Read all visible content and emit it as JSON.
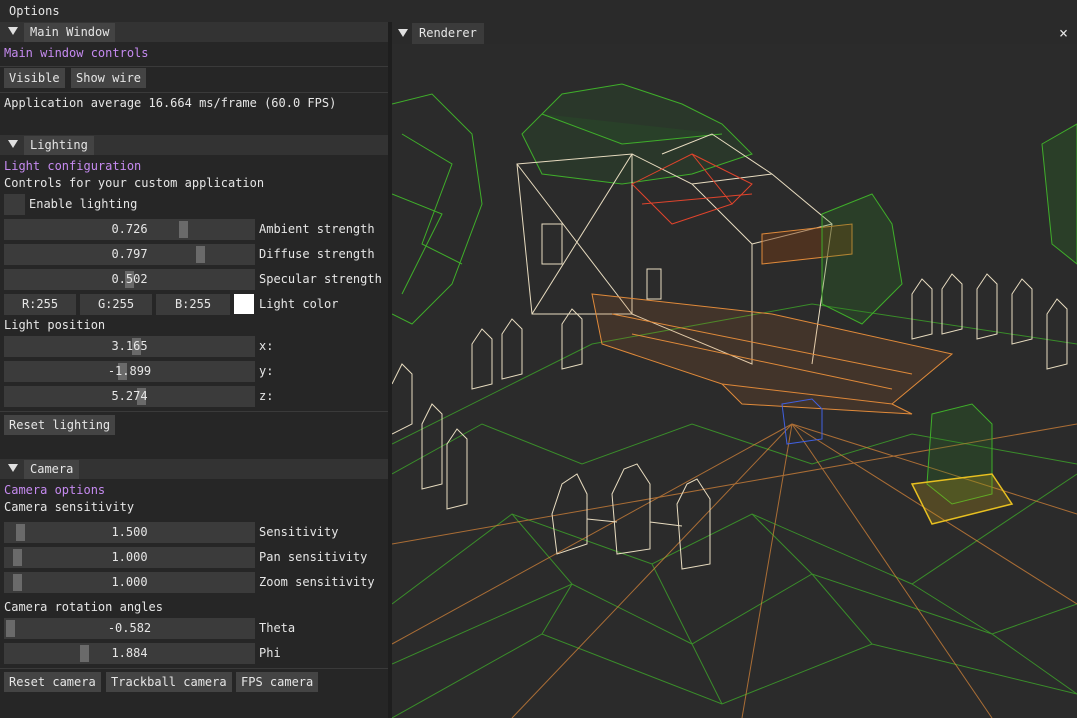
{
  "window_title": "Options",
  "main_window": {
    "header": "Main Window",
    "section_label": "Main window controls",
    "visible_button": "Visible",
    "show_wire_button": "Show wire",
    "fps_text": "Application average 16.664 ms/frame (60.0 FPS)"
  },
  "lighting": {
    "header": "Lighting",
    "section_label": "Light configuration",
    "subtitle": "Controls for your custom application",
    "enable_label": "Enable lighting",
    "enable_checked": false,
    "ambient": {
      "value": "0.726",
      "fraction": 0.726,
      "label": "Ambient strength"
    },
    "diffuse": {
      "value": "0.797",
      "fraction": 0.797,
      "label": "Diffuse strength"
    },
    "specular": {
      "value": "0.502",
      "fraction": 0.502,
      "label": "Specular strength"
    },
    "color": {
      "r": "R:255",
      "g": "G:255",
      "b": "B:255",
      "label": "Light color",
      "swatch": "#ffffff"
    },
    "position_label": "Light position",
    "pos_x": {
      "value": "3.165",
      "fraction": 0.53,
      "label": "x:"
    },
    "pos_y": {
      "value": "-1.899",
      "fraction": 0.47,
      "label": "y:"
    },
    "pos_z": {
      "value": "5.274",
      "fraction": 0.55,
      "label": "z:"
    },
    "reset_button": "Reset lighting"
  },
  "camera": {
    "header": "Camera",
    "section_label": "Camera options",
    "sensitivity_label": "Camera sensitivity",
    "sensitivity": {
      "value": "1.500",
      "fraction": 0.04,
      "label": "Sensitivity"
    },
    "pan": {
      "value": "1.000",
      "fraction": 0.03,
      "label": "Pan sensitivity"
    },
    "zoom": {
      "value": "1.000",
      "fraction": 0.03,
      "label": "Zoom sensitivity"
    },
    "rotation_label": "Camera rotation angles",
    "theta": {
      "value": "-0.582",
      "fraction": 0.0,
      "label": "Theta"
    },
    "phi": {
      "value": "1.884",
      "fraction": 0.31,
      "label": "Phi"
    },
    "reset_button": "Reset camera",
    "trackball_button": "Trackball camera",
    "fps_button": "FPS camera"
  },
  "renderer": {
    "tab": "Renderer",
    "close_glyph": "×"
  },
  "colors": {
    "accent_purple": "#c58af0",
    "wire_green": "#3fae2a",
    "wire_orange": "#e08a3a",
    "wire_red": "#e0442c",
    "wire_cream": "#e8dcc0",
    "wire_yellow": "#e8c020"
  }
}
